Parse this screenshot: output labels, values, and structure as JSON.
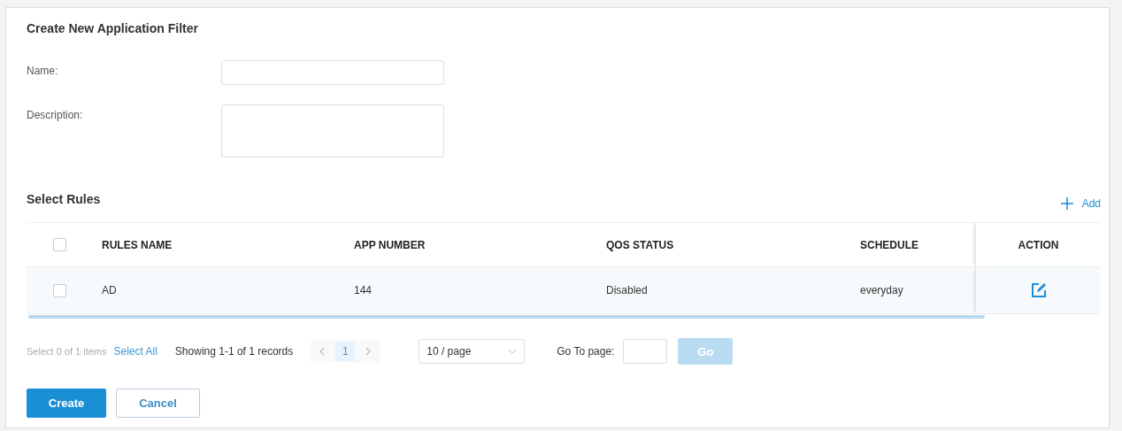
{
  "title": "Create New Application Filter",
  "fields": [
    {
      "label": "Name:",
      "kind": "text"
    },
    {
      "label": "Description:",
      "kind": "textarea"
    }
  ],
  "rules": {
    "title": "Select Rules",
    "add_label": "Add",
    "header_checked": false,
    "columns": [
      {
        "label": "RULES NAME"
      },
      {
        "label": "APP NUMBER"
      },
      {
        "label": "QOS STATUS"
      },
      {
        "label": "SCHEDULE"
      },
      {
        "label": "ACTION",
        "kind": "action"
      }
    ],
    "rows": [
      {
        "checked": false,
        "cells": [
          "AD",
          "144",
          "Disabled",
          "everyday"
        ]
      }
    ],
    "footer": {
      "selection": "Select 0 of 1 items",
      "select_all": "Select All",
      "showing": "Showing 1-1 of 1 records",
      "prev_disabled": true,
      "next_disabled": true,
      "pages": [
        {
          "label": "1",
          "selected": true
        }
      ],
      "page_size": "10 / page",
      "goto_label": "Go To page:",
      "go": {
        "label": "Go",
        "disabled": true
      }
    }
  },
  "buttons": [
    {
      "label": "Create",
      "kind": "primary"
    },
    {
      "label": "Cancel",
      "kind": "secondary"
    }
  ]
}
